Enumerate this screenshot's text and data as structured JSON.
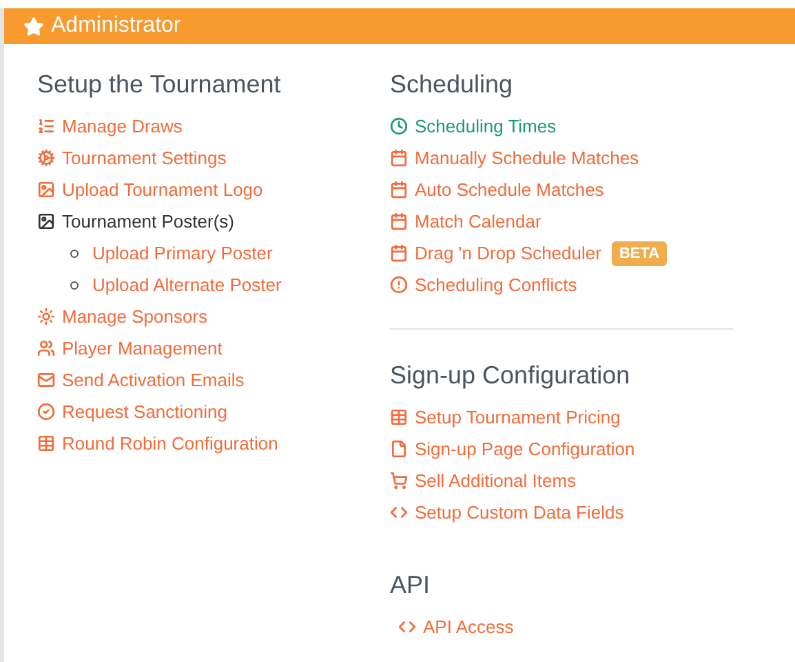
{
  "panel": {
    "title": "Administrator"
  },
  "columns": [
    {
      "sections": [
        {
          "heading": "Setup the Tournament",
          "items": [
            {
              "label": "Manage Draws",
              "color": "#f26b3a"
            },
            {
              "label": "Tournament Settings",
              "color": "#f26b3a"
            },
            {
              "label": "Upload Tournament Logo",
              "color": "#f26b3a"
            },
            {
              "label": "Tournament Poster(s)",
              "color": "#333333",
              "children": [
                {
                  "label": "Upload Primary Poster",
                  "color": "#f26b3a"
                },
                {
                  "label": "Upload Alternate Poster",
                  "color": "#f26b3a"
                }
              ]
            },
            {
              "label": "Manage Sponsors",
              "color": "#f26b3a"
            },
            {
              "label": "Player Management",
              "color": "#f26b3a"
            },
            {
              "label": "Send Activation Emails",
              "color": "#f26b3a"
            },
            {
              "label": "Request Sanctioning",
              "color": "#f26b3a"
            },
            {
              "label": "Round Robin Configuration",
              "color": "#f26b3a"
            }
          ]
        }
      ]
    },
    {
      "sections": [
        {
          "heading": "Scheduling",
          "items": [
            {
              "label": "Scheduling Times",
              "color": "#1a9a72"
            },
            {
              "label": "Manually Schedule Matches",
              "color": "#f26b3a"
            },
            {
              "label": "Auto Schedule Matches",
              "color": "#f26b3a"
            },
            {
              "label": "Match Calendar",
              "color": "#f26b3a"
            },
            {
              "label": "Drag 'n Drop Scheduler",
              "color": "#f26b3a",
              "badge": "BETA"
            },
            {
              "label": "Scheduling Conflicts",
              "color": "#f26b3a"
            }
          ]
        },
        {
          "heading": "Sign-up Configuration",
          "items": [
            {
              "label": "Setup Tournament Pricing",
              "color": "#f26b3a"
            },
            {
              "label": "Sign-up Page Configuration",
              "color": "#f26b3a"
            },
            {
              "label": "Sell Additional Items",
              "color": "#f26b3a"
            },
            {
              "label": "Setup Custom Data Fields",
              "color": "#f26b3a"
            }
          ]
        },
        {
          "heading": "API",
          "items": [
            {
              "label": "API Access",
              "color": "#f26b3a"
            }
          ]
        }
      ]
    }
  ]
}
